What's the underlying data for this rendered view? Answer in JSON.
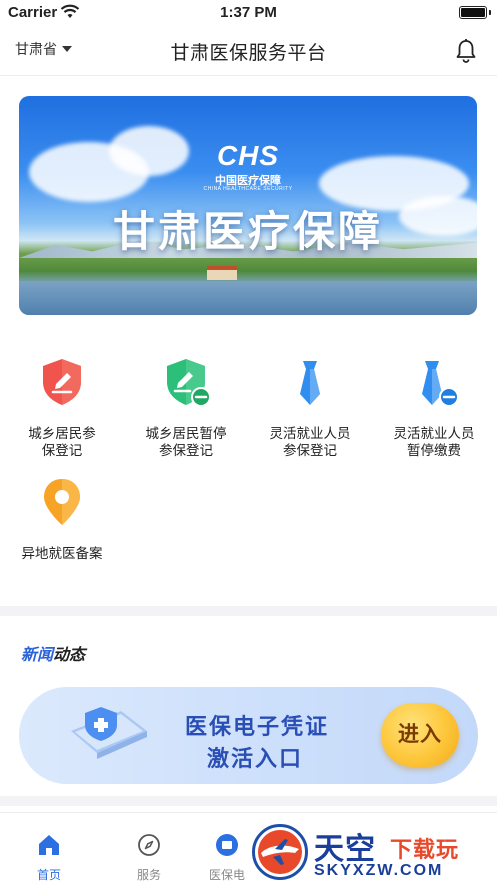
{
  "status_bar": {
    "carrier": "Carrier",
    "time": "1:37 PM"
  },
  "navbar": {
    "province": "甘肃省",
    "title": "甘肃医保服务平台"
  },
  "banner": {
    "logo": "CHS",
    "logo_sub": "中国医疗保障",
    "logo_tiny": "CHINA HEALTHCARE SECURITY",
    "title": "甘肃医疗保障"
  },
  "services": [
    {
      "label_line1": "城乡居民参",
      "label_line2": "保登记",
      "icon": "shield-edit-icon",
      "color": "#f0544d"
    },
    {
      "label_line1": "城乡居民暂停",
      "label_line2": "参保登记",
      "icon": "shield-edit-pause-icon",
      "color": "#2cbf7a"
    },
    {
      "label_line1": "灵活就业人员",
      "label_line2": "参保登记",
      "icon": "tie-icon",
      "color": "#2f8ef0"
    },
    {
      "label_line1": "灵活就业人员",
      "label_line2": "暂停缴费",
      "icon": "tie-pause-icon",
      "color": "#2f8ef0"
    },
    {
      "label_line1": "异地就医备案",
      "label_line2": "",
      "icon": "location-pin-icon",
      "color": "#f7a325"
    }
  ],
  "news": {
    "title_a": "新闻",
    "title_b": "动态"
  },
  "promo": {
    "line1": "医保电子凭证",
    "line2": "激活入口",
    "button": "进入"
  },
  "tabbar": {
    "items": [
      {
        "label": "首页",
        "icon": "home-icon",
        "active": true
      },
      {
        "label": "服务",
        "icon": "compass-icon",
        "active": false
      },
      {
        "label": "医保电",
        "icon": "card-icon",
        "active": false
      }
    ]
  },
  "watermark": {
    "line1a": "天空",
    "line1b": "下载玩",
    "line2": "SKYXZW.COM"
  },
  "colors": {
    "accent": "#2b6fe0",
    "news_blue": "#2b63d9",
    "promo_text": "#2a4fb4",
    "button_gold": "#fdc63a"
  }
}
